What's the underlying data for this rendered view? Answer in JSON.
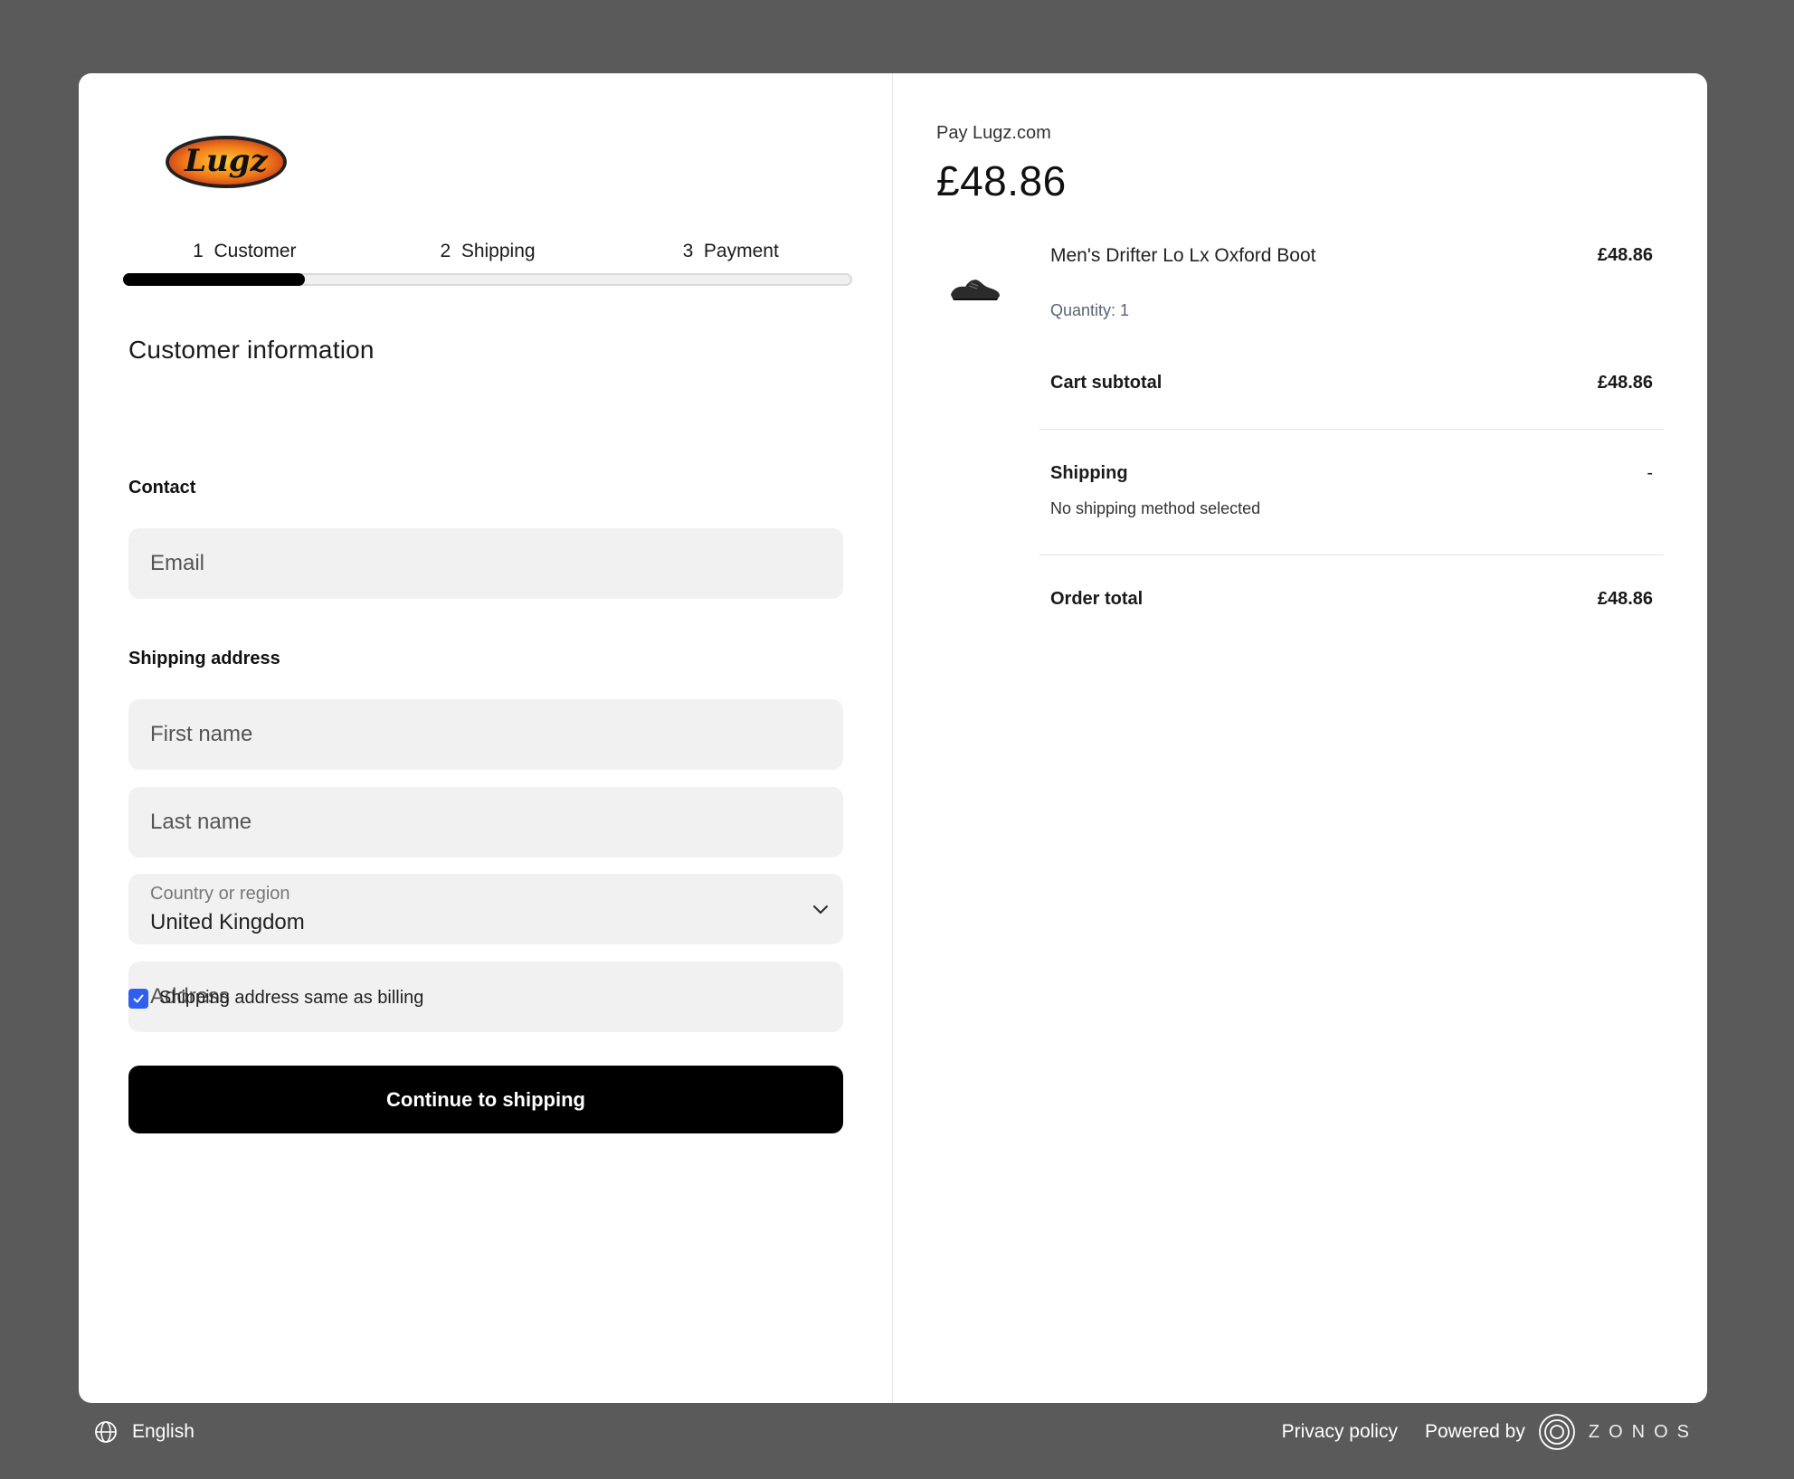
{
  "brand": {
    "logo_text": "Lugz"
  },
  "stepper": {
    "steps": [
      {
        "number": "1",
        "label": "Customer"
      },
      {
        "number": "2",
        "label": "Shipping"
      },
      {
        "number": "3",
        "label": "Payment"
      }
    ],
    "progress": 0.25
  },
  "form": {
    "title": "Customer information",
    "contact_label": "Contact",
    "email_placeholder": "Email",
    "shipping_label": "Shipping address",
    "first_name_placeholder": "First name",
    "last_name_placeholder": "Last name",
    "country_label": "Country or region",
    "country_value": "United Kingdom",
    "address_placeholder": "Address",
    "same_as_billing_label": "Shipping address same as billing",
    "same_as_billing_checked": true,
    "continue_label": "Continue to shipping"
  },
  "summary": {
    "pay_label": "Pay Lugz.com",
    "amount": "£48.86",
    "product_name": "Men's Drifter Lo Lx Oxford Boot",
    "product_price": "£48.86",
    "quantity": "Quantity: 1",
    "subtotal_label": "Cart subtotal",
    "subtotal_value": "£48.86",
    "shipping_label": "Shipping",
    "shipping_value": "-",
    "shipping_note": "No shipping method selected",
    "total_label": "Order total",
    "total_value": "£48.86"
  },
  "footer": {
    "language": "English",
    "privacy": "Privacy policy",
    "powered_by": "Powered by",
    "provider": "ZONOS"
  },
  "colors": {
    "accent_checkbox": "#2f5ef0",
    "cta_bg": "#000000",
    "backdrop": "#5a5a5a"
  }
}
